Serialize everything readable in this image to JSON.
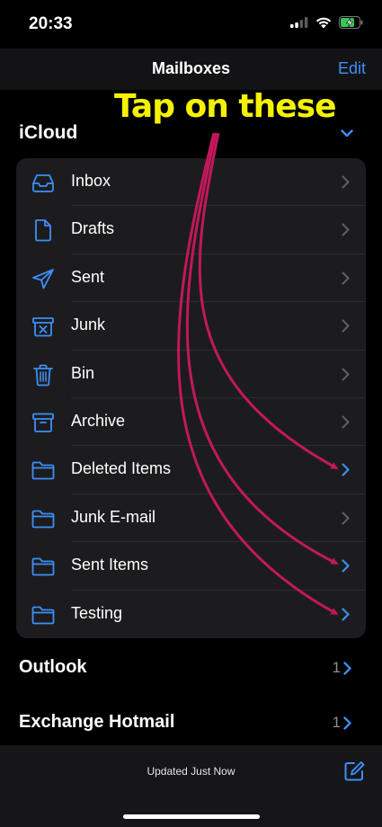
{
  "status_bar": {
    "time": "20:33",
    "icons": [
      "signal-icon",
      "wifi-icon",
      "battery-charging-icon"
    ]
  },
  "nav": {
    "title": "Mailboxes",
    "edit": "Edit"
  },
  "annotation": {
    "text": "Tap on these"
  },
  "icloud": {
    "title": "iCloud",
    "mailboxes": [
      {
        "label": "Inbox",
        "icon": "inbox-tray-icon",
        "highlighted": false
      },
      {
        "label": "Drafts",
        "icon": "document-icon",
        "highlighted": false
      },
      {
        "label": "Sent",
        "icon": "paper-plane-icon",
        "highlighted": false
      },
      {
        "label": "Junk",
        "icon": "junk-box-icon",
        "highlighted": false
      },
      {
        "label": "Bin",
        "icon": "trash-icon",
        "highlighted": false
      },
      {
        "label": "Archive",
        "icon": "archive-box-icon",
        "highlighted": false
      },
      {
        "label": "Deleted Items",
        "icon": "folder-icon",
        "highlighted": true
      },
      {
        "label": "Junk E-mail",
        "icon": "folder-icon",
        "highlighted": false
      },
      {
        "label": "Sent Items",
        "icon": "folder-icon",
        "highlighted": true
      },
      {
        "label": "Testing",
        "icon": "folder-icon",
        "highlighted": true
      }
    ]
  },
  "accounts": [
    {
      "title": "Outlook",
      "count": "1"
    },
    {
      "title": "Exchange Hotmail",
      "count": "1"
    }
  ],
  "toolbar": {
    "status": "Updated Just Now",
    "compose_icon": "compose-icon"
  },
  "colors": {
    "accent": "#3d8ff6",
    "annotation_text": "#f5f200",
    "annotation_arrow": "#c2185b",
    "group_bg": "#1c1c1e"
  }
}
